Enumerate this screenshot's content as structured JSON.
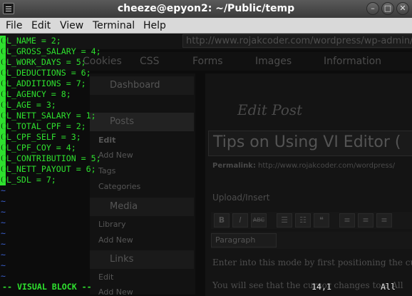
{
  "window": {
    "title": "cheeze@epyon2: ~/Public/temp",
    "buttons": {
      "minimize": "–",
      "maximize": "□",
      "close": "✕"
    }
  },
  "menu": [
    "File",
    "Edit",
    "View",
    "Terminal",
    "Help"
  ],
  "background_browser": {
    "url": "http://www.rojakcoder.com/wordpress/wp-admin/",
    "bookmarks": [
      "Cookies",
      "CSS",
      "Forms",
      "Images",
      "Information"
    ],
    "admin_menu": {
      "dashboard": "Dashboard",
      "posts": "Posts",
      "posts_items": [
        "Edit",
        "Add New",
        "Tags",
        "Categories"
      ],
      "media": "Media",
      "media_items": [
        "Library",
        "Add New"
      ],
      "links": "Links",
      "links_items": [
        "Edit",
        "Add New"
      ]
    },
    "page_heading": "Edit Post",
    "post_title": "Tips on Using VI Editor (",
    "permalink_label": "Permalink:",
    "permalink_url": "http://www.rojakcoder.com/wordpress/",
    "upload_insert": "Upload/Insert",
    "format_select": "Paragraph",
    "body_lines": [
      "Enter into this mode by first positioning the cu",
      "You will see that the cursor changes to a All"
    ]
  },
  "vim": {
    "lines": [
      "OL_NAME = 2;",
      "OL_GROSS_SALARY = 4;",
      "OL_WORK_DAYS = 5;",
      "OL_DEDUCTIONS = 6;",
      "OL_ADDITIONS = 7;",
      "OL_AGENCY = 8;",
      "OL_AGE = 3;",
      "OL_NETT_SALARY = 1;",
      "OL_TOTAL_CPF = 2;",
      "OL_CPF_SELF = 3;",
      "OL_CPF_COY = 4;",
      "OL_CONTRIBUTION = 5;",
      "OL_NETT_PAYOUT = 6;",
      "OL_SDL = 7;"
    ],
    "selected_column_text": "C",
    "empty_line_marker": "~",
    "empty_line_count": 9,
    "mode": "-- VISUAL BLOCK --",
    "cursor_position": "14,1",
    "scroll_position": "All",
    "colors": {
      "text": "#2ee02e",
      "tilde": "#3a5fcd",
      "background": "#000000"
    }
  }
}
